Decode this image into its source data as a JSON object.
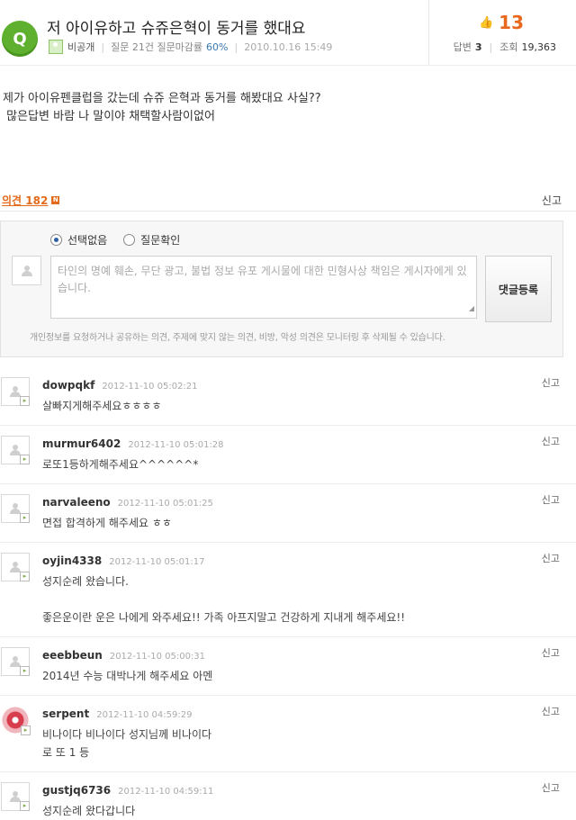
{
  "question": {
    "badge": "Q",
    "title": "저 아이유하고 슈쥬은혁이 동거를 했대요",
    "author": "비공개",
    "question_stats": "질문 21건 질문마감률",
    "close_rate": "60%",
    "date": "2010.10.16 15:49",
    "score": "13",
    "answers_label": "답변",
    "answers_count": "3",
    "views_label": "조회",
    "views_count": "19,363",
    "body": "제가 아이유펜클럽을 갔는데 슈쥬 은혁과 동거를 해봤대요 사실??\n 많은답변 바람 나 말이야 채택할사람이없어"
  },
  "opinions": {
    "label": "의견 182",
    "new_badge": "N",
    "report": "신고"
  },
  "form": {
    "radio_none": "선택없음",
    "radio_check": "질문확인",
    "placeholder": "타인의 명예 훼손, 무단 광고, 불법 정보 유포 게시물에 대한 민형사상 책임은 게시자에게 있습니다.",
    "submit": "댓글등록",
    "notice": "개인정보를 요청하거나 공유하는 의견, 주제에 맞지 않는 의견, 비방, 악성 의견은 모니터링 후 삭제될 수 있습니다."
  },
  "comments": [
    {
      "user": "dowpqkf",
      "date": "2012-11-10 05:02:21",
      "text": "살빠지게해주세요ㅎㅎㅎㅎ",
      "report": "신고"
    },
    {
      "user": "murmur6402",
      "date": "2012-11-10 05:01:28",
      "text": "로또1등하게해주세요^^^^^^*",
      "report": "신고"
    },
    {
      "user": "narvaleeno",
      "date": "2012-11-10 05:01:25",
      "text": "면접 합격하게 해주세요 ㅎㅎ",
      "report": "신고"
    },
    {
      "user": "oyjin4338",
      "date": "2012-11-10 05:01:17",
      "text": "성지순례 왔습니다.\n\n좋은운이란 운은 나에게 와주세요!! 가족 아프지말고 건강하게 지내게 해주세요!!",
      "report": "신고"
    },
    {
      "user": "eeebbeun",
      "date": "2012-11-10 05:00:31",
      "text": "2014년 수능 대박나게 해주세요 아멘",
      "report": "신고"
    },
    {
      "user": "serpent",
      "date": "2012-11-10 04:59:29",
      "text": "비나이다 비나이다 성지님께 비나이다\n로 또 1 등",
      "report": "신고"
    },
    {
      "user": "gustjq6736",
      "date": "2012-11-10 04:59:11",
      "text": "성지순례 왔다갑니다",
      "report": "신고"
    }
  ]
}
